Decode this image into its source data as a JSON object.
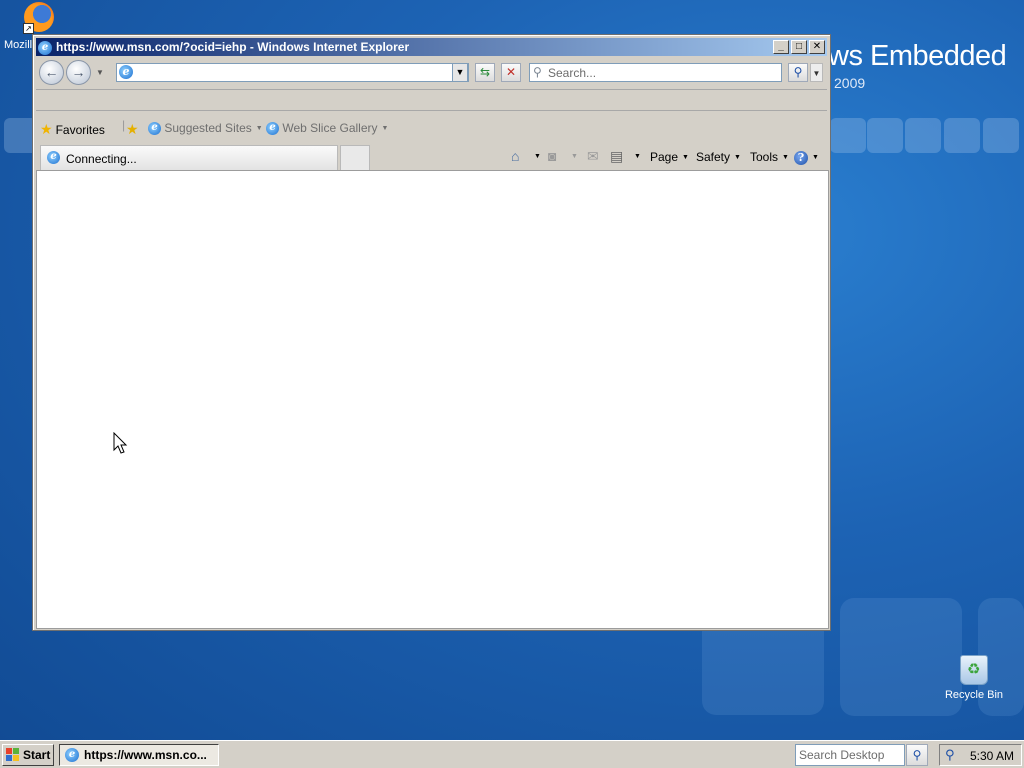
{
  "desktop": {
    "brand_text": "ws Embedded",
    "brand_year": "2009",
    "firefox_label": "Mozilla",
    "recycle_bin_label": "Recycle Bin"
  },
  "window": {
    "title": "https://www.msn.com/?ocid=iehp - Windows Internet Explorer",
    "minimize": "_",
    "maximize": "□",
    "close": "✕"
  },
  "toolbar": {
    "address_value": "",
    "search_placeholder": "Search..."
  },
  "favorites_bar": {
    "favorites_label": "Favorites",
    "suggested_sites_label": "Suggested Sites",
    "web_slice_gallery_label": "Web Slice Gallery"
  },
  "tab": {
    "label": "Connecting..."
  },
  "command_bar": {
    "page_label": "Page",
    "safety_label": "Safety",
    "tools_label": "Tools"
  },
  "taskbar": {
    "start_label": "Start",
    "task_label": "https://www.msn.co...",
    "search_placeholder": "Search Desktop",
    "clock": "5:30 AM"
  },
  "colors": {
    "desktop_blue": "#1d63b4",
    "titlebar_start": "#0a246a",
    "titlebar_end": "#a6caf0",
    "chrome_gray": "#d4d0c8"
  }
}
